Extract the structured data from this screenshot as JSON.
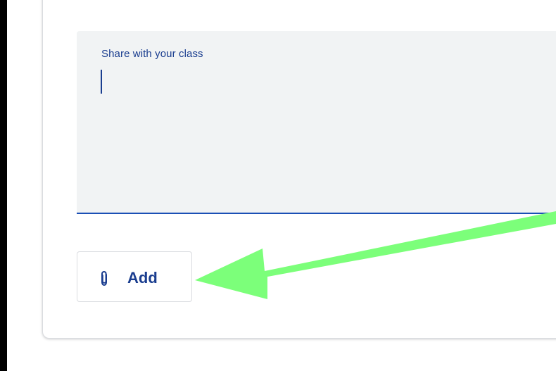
{
  "composer": {
    "placeholder_label": "Share with your class"
  },
  "attachments": {
    "add_label": "Add",
    "icon": "paperclip-icon"
  },
  "colors": {
    "accent": "#1a3d8f",
    "focus_underline": "#1a4fb5",
    "field_background": "#f1f3f4",
    "annotation_arrow": "#7cff7a"
  }
}
